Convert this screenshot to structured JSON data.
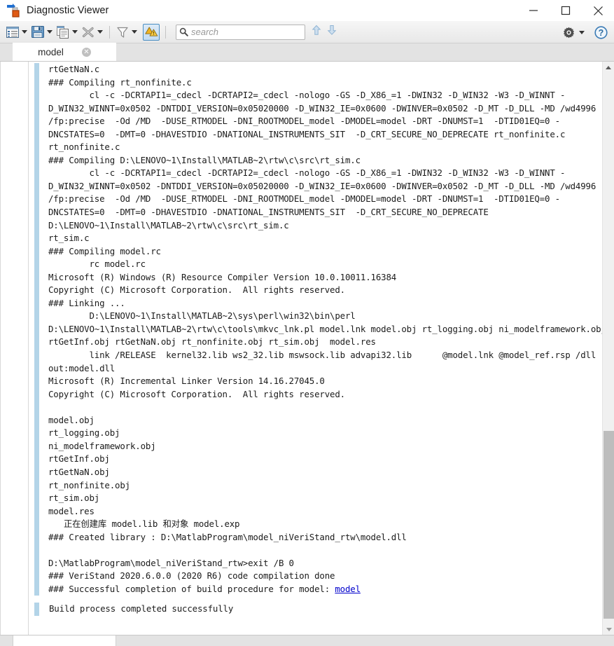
{
  "window": {
    "title": "Diagnostic Viewer",
    "icon": "diagnostic-viewer-icon",
    "controls": {
      "minimize": "minimize-icon",
      "maximize": "maximize-icon",
      "close": "close-icon"
    }
  },
  "toolbar": {
    "items": [
      {
        "name": "view-options",
        "icon": "list-view-icon",
        "has_caret": true
      },
      {
        "name": "save",
        "icon": "save-disk-icon",
        "has_caret": true
      },
      {
        "name": "copy",
        "icon": "copy-pages-icon",
        "has_caret": true
      },
      {
        "name": "clear",
        "icon": "clear-x-icon",
        "has_caret": true
      },
      {
        "name": "filter",
        "icon": "funnel-filter-icon",
        "has_caret": true
      },
      {
        "name": "warnings-toggle",
        "icon": "warning-triangles-icon",
        "has_caret": false,
        "active": true
      }
    ],
    "search": {
      "placeholder": "search",
      "value": "",
      "icon": "search-icon"
    },
    "nav": {
      "previous": "arrow-up-icon",
      "next": "arrow-down-icon"
    },
    "settings": {
      "icon": "gear-icon",
      "has_caret": true
    },
    "help": {
      "icon": "help-question-icon"
    }
  },
  "tabs": [
    {
      "label": "model",
      "close_label": "✕",
      "active": true
    }
  ],
  "messages": [
    {
      "id": "build-log",
      "accent": "#b3d4e8",
      "lines": [
        "rtGetNaN.c",
        "### Compiling rt_nonfinite.c",
        "        cl -c -DCRTAPI1=_cdecl -DCRTAPI2=_cdecl -nologo -GS -D_X86_=1 -DWIN32 -D_WIN32 -W3 -D_WINNT -D_WIN32_WINNT=0x0502 -DNTDDI_VERSION=0x05020000 -D_WIN32_IE=0x0600 -DWINVER=0x0502 -D_MT -D_DLL -MD /wd4996 /fp:precise  -Od /MD  -DUSE_RTMODEL -DNI_ROOTMODEL_model -DMODEL=model -DRT -DNUMST=1  -DTID01EQ=0 -DNCSTATES=0  -DMT=0 -DHAVESTDIO -DNATIONAL_INSTRUMENTS_SIT  -D_CRT_SECURE_NO_DEPRECATE rt_nonfinite.c",
        "rt_nonfinite.c",
        "### Compiling D:\\LENOVO~1\\Install\\MATLAB~2\\rtw\\c\\src\\rt_sim.c",
        "        cl -c -DCRTAPI1=_cdecl -DCRTAPI2=_cdecl -nologo -GS -D_X86_=1 -DWIN32 -D_WIN32 -W3 -D_WINNT -D_WIN32_WINNT=0x0502 -DNTDDI_VERSION=0x05020000 -D_WIN32_IE=0x0600 -DWINVER=0x0502 -D_MT -D_DLL -MD /wd4996 /fp:precise  -Od /MD  -DUSE_RTMODEL -DNI_ROOTMODEL_model -DMODEL=model -DRT -DNUMST=1  -DTID01EQ=0 -DNCSTATES=0  -DMT=0 -DHAVESTDIO -DNATIONAL_INSTRUMENTS_SIT  -D_CRT_SECURE_NO_DEPRECATE D:\\LENOVO~1\\Install\\MATLAB~2\\rtw\\c\\src\\rt_sim.c",
        "rt_sim.c",
        "### Compiling model.rc",
        "        rc model.rc",
        "Microsoft (R) Windows (R) Resource Compiler Version 10.0.10011.16384",
        "Copyright (C) Microsoft Corporation.  All rights reserved.",
        "### Linking ...",
        "        D:\\LENOVO~1\\Install\\MATLAB~2\\sys\\perl\\win32\\bin\\perl D:\\LENOVO~1\\Install\\MATLAB~2\\rtw\\c\\tools\\mkvc_lnk.pl model.lnk model.obj rt_logging.obj ni_modelframework.obj rtGetInf.obj rtGetNaN.obj rt_nonfinite.obj rt_sim.obj  model.res",
        "        link /RELEASE  kernel32.lib ws2_32.lib mswsock.lib advapi32.lib      @model.lnk @model_ref.rsp /dll -out:model.dll",
        "Microsoft (R) Incremental Linker Version 14.16.27045.0",
        "Copyright (C) Microsoft Corporation.  All rights reserved.",
        "",
        "model.obj",
        "rt_logging.obj",
        "ni_modelframework.obj",
        "rtGetInf.obj",
        "rtGetNaN.obj",
        "rt_nonfinite.obj",
        "rt_sim.obj",
        "model.res",
        "   正在创建库 model.lib 和对象 model.exp",
        "### Created library : D:\\MatlabProgram\\model_niVeriStand_rtw\\model.dll",
        "",
        "D:\\MatlabProgram\\model_niVeriStand_rtw>exit /B 0",
        "### VeriStand 2020.6.0.0 (2020 R6) code compilation done"
      ],
      "final_line_prefix": "### Successful completion of build procedure for model: ",
      "final_line_link": "model"
    }
  ],
  "status": {
    "accent": "#b3d4e8",
    "text": "Build process completed successfully"
  },
  "scrollbar": {
    "up_arrow": "scroll-up-arrow-icon",
    "down_arrow": "scroll-down-arrow-icon",
    "thumb": "vertical-scroll-thumb"
  },
  "colors": {
    "accent_bar": "#b3d4e8",
    "link": "#0000cc",
    "toolbar_bg": "#efefef",
    "tab_active_bg": "#ffffff",
    "tabstrip_bg": "#e3e3e3"
  }
}
